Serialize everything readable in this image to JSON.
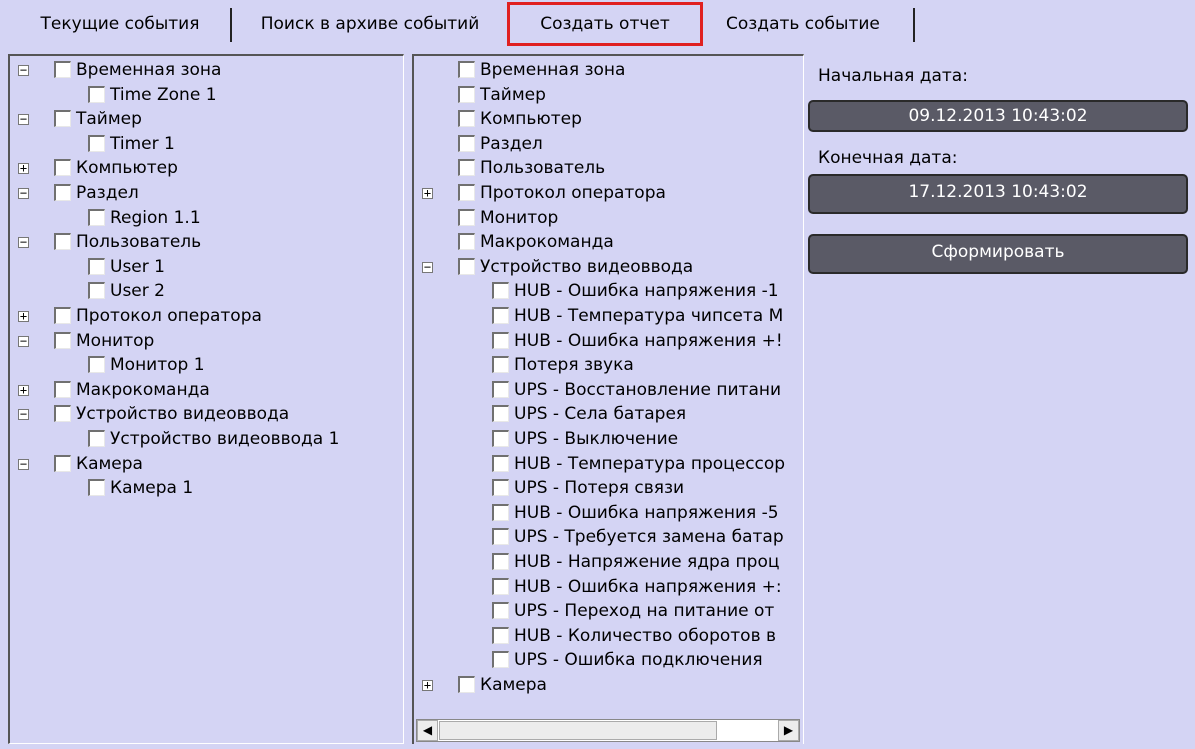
{
  "tabs": [
    {
      "label": "Текущие события"
    },
    {
      "label": "Поиск в архиве событий"
    },
    {
      "label": "Создать отчет"
    },
    {
      "label": "Создать событие"
    }
  ],
  "active_tab": "Создать отчет",
  "left_tree": [
    {
      "label": "Временная зона",
      "expander": "−"
    },
    {
      "label": "Time Zone 1"
    },
    {
      "label": "Таймер",
      "expander": "−"
    },
    {
      "label": "Timer 1"
    },
    {
      "label": "Компьютер",
      "expander": "+"
    },
    {
      "label": "Раздел",
      "expander": "−"
    },
    {
      "label": "Region 1.1"
    },
    {
      "label": "Пользователь",
      "expander": "−"
    },
    {
      "label": "User 1"
    },
    {
      "label": "User 2"
    },
    {
      "label": "Протокол оператора",
      "expander": "+"
    },
    {
      "label": "Монитор",
      "expander": "−"
    },
    {
      "label": "Монитор 1"
    },
    {
      "label": "Макрокоманда",
      "expander": "+"
    },
    {
      "label": "Устройство видеоввода",
      "expander": "−"
    },
    {
      "label": "Устройство видеоввода 1"
    },
    {
      "label": "Камера",
      "expander": "−"
    },
    {
      "label": "Камера 1"
    }
  ],
  "mid_tree": [
    {
      "label": "Временная зона"
    },
    {
      "label": "Таймер"
    },
    {
      "label": "Компьютер"
    },
    {
      "label": "Раздел"
    },
    {
      "label": "Пользователь"
    },
    {
      "label": "Протокол оператора",
      "expander": "+"
    },
    {
      "label": "Монитор"
    },
    {
      "label": "Макрокоманда"
    },
    {
      "label": "Устройство видеоввода",
      "expander": "−"
    },
    {
      "label": "HUB - Ошибка напряжения -1"
    },
    {
      "label": "HUB - Температура чипсета М"
    },
    {
      "label": "HUB - Ошибка напряжения +!"
    },
    {
      "label": "Потеря звука"
    },
    {
      "label": "UPS - Восстановление питани"
    },
    {
      "label": "UPS - Села батарея"
    },
    {
      "label": "UPS - Выключение"
    },
    {
      "label": "HUB - Температура процессор"
    },
    {
      "label": "UPS - Потеря связи"
    },
    {
      "label": "HUB - Ошибка напряжения -5"
    },
    {
      "label": "UPS - Требуется замена батар"
    },
    {
      "label": "HUB - Напряжение ядра проц"
    },
    {
      "label": "HUB - Ошибка напряжения +:"
    },
    {
      "label": "UPS - Переход на питание от"
    },
    {
      "label": "HUB - Количество оборотов в"
    },
    {
      "label": "UPS - Ошибка подключения"
    },
    {
      "label": "Камера",
      "expander": "+"
    }
  ],
  "scrollbar": {
    "left_arrow": "◀",
    "right_arrow": "▶"
  },
  "report": {
    "start_label": "Начальная дата:",
    "start_value": "09.12.2013 10:43:02",
    "end_label": "Конечная дата:",
    "end_value": "17.12.2013 10:43:02",
    "generate_label": "Сформировать"
  }
}
